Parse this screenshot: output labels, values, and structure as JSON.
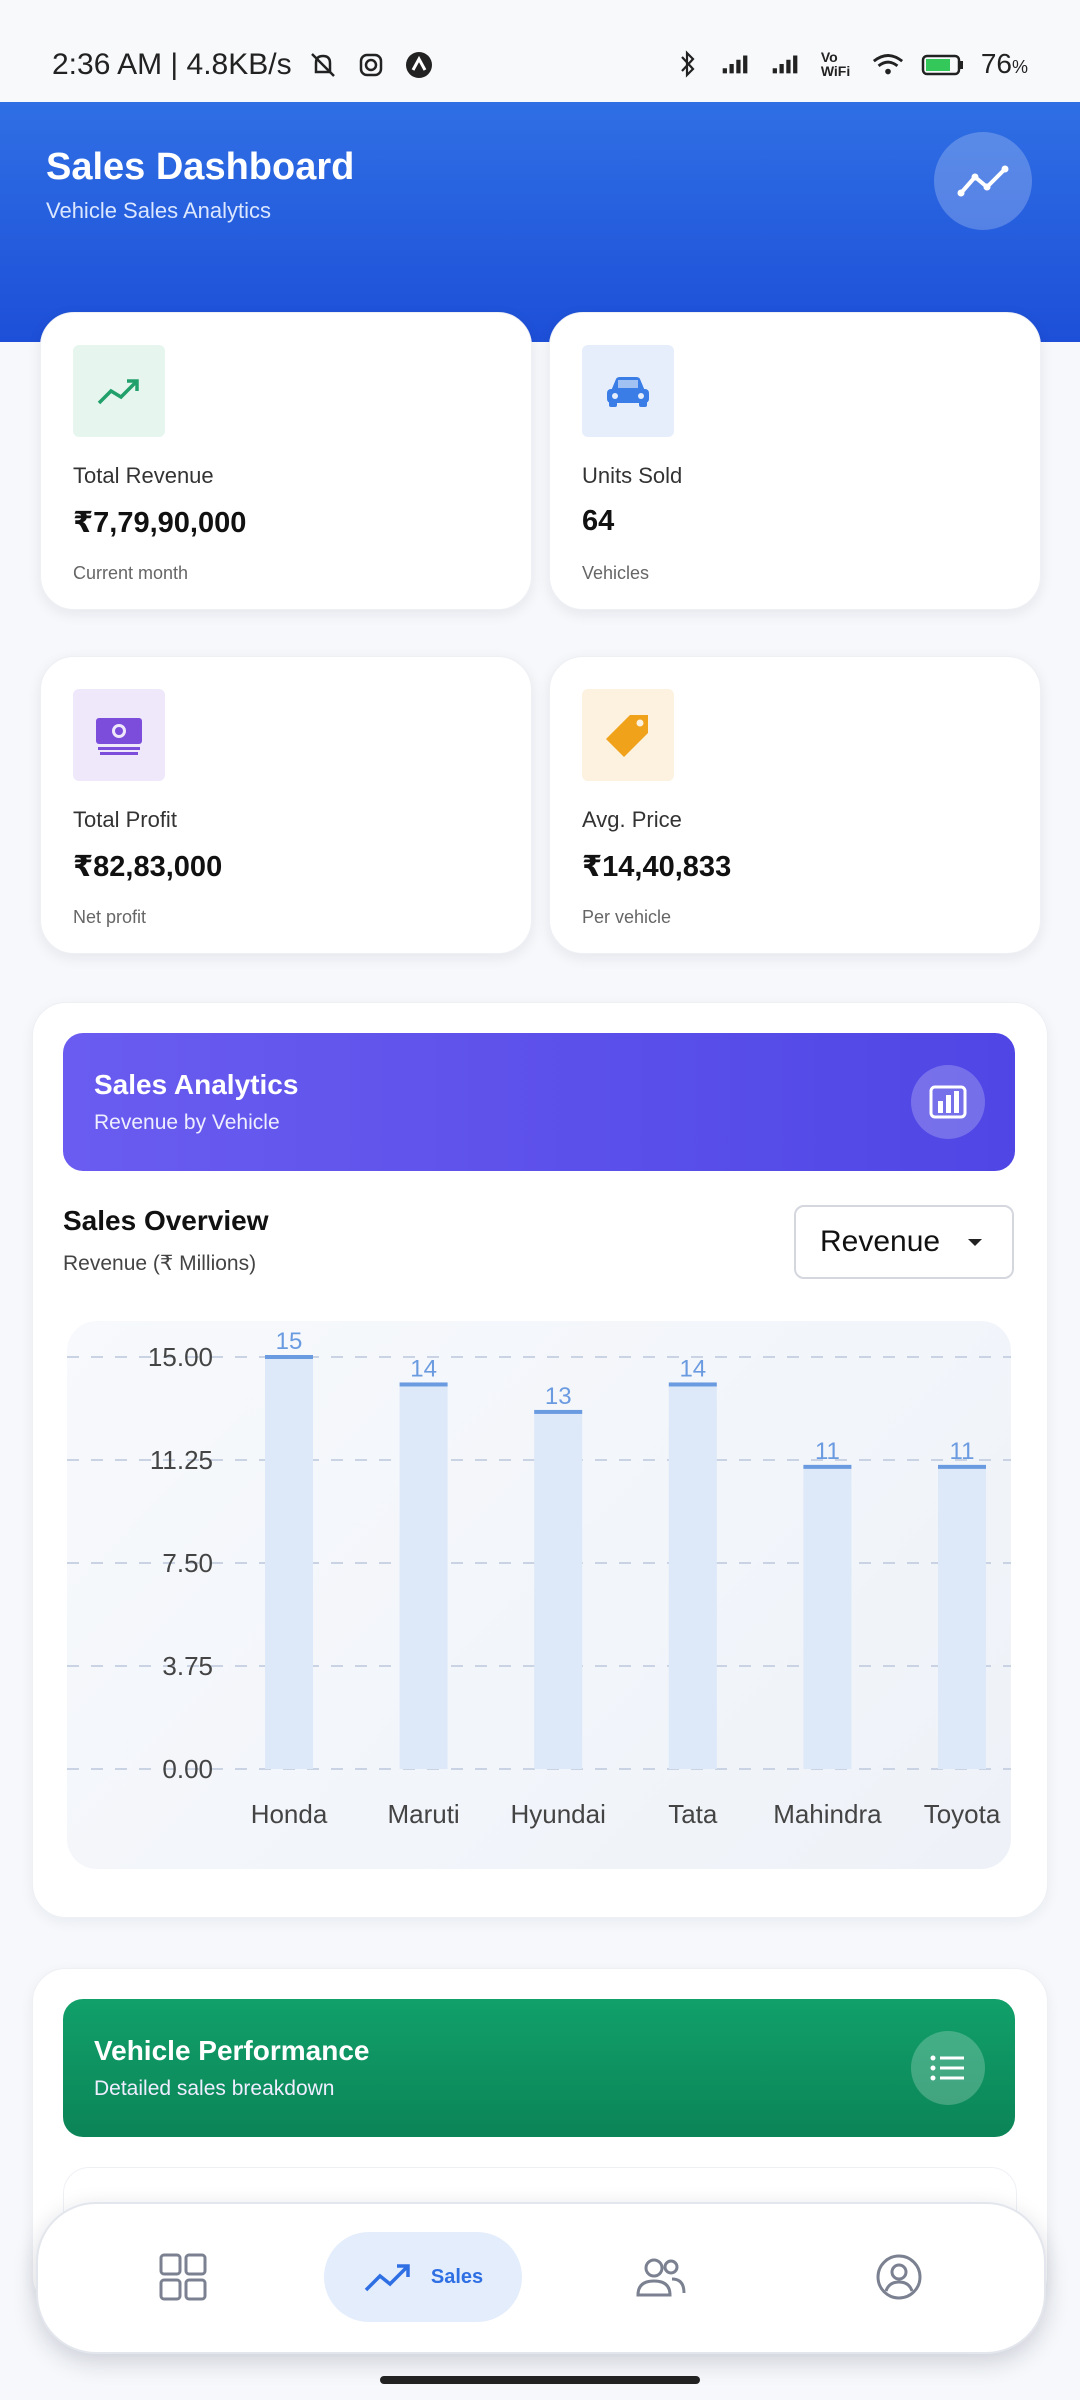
{
  "status_bar": {
    "time_speed": "2:36 AM | 4.8KB/s",
    "vowifi": "Vo WiFi",
    "battery": "76"
  },
  "header": {
    "title": "Sales Dashboard",
    "subtitle": "Vehicle Sales Analytics"
  },
  "stats": [
    {
      "label": "Total Revenue",
      "value": "₹7,79,90,000",
      "note": "Current month",
      "icon": "trending-up-icon",
      "icon_color": "#22a06b",
      "icon_bg": "#e6f6ef"
    },
    {
      "label": "Units Sold",
      "value": "64",
      "note": "Vehicles",
      "icon": "car-icon",
      "icon_color": "#3b7de6",
      "icon_bg": "#e6eefb"
    },
    {
      "label": "Total Profit",
      "value": "₹82,83,000",
      "note": "Net profit",
      "icon": "money-icon",
      "icon_color": "#7c4ddb",
      "icon_bg": "#efe8fb"
    },
    {
      "label": "Avg. Price",
      "value": "₹14,40,833",
      "note": "Per vehicle",
      "icon": "tag-icon",
      "icon_color": "#f0a21b",
      "icon_bg": "#fdf2e0"
    }
  ],
  "analytics": {
    "title": "Sales Analytics",
    "subtitle": "Revenue by Vehicle",
    "color_from": "#6a5cf0",
    "color_to": "#4f46e5"
  },
  "overview": {
    "title": "Sales Overview",
    "subtitle": "Revenue (₹ Millions)",
    "dropdown_value": "Revenue"
  },
  "chart_data": {
    "type": "bar",
    "categories": [
      "Honda",
      "Maruti",
      "Hyundai",
      "Tata",
      "Mahindra",
      "Toyota"
    ],
    "values": [
      15,
      14,
      13,
      14,
      11,
      11
    ],
    "data_labels": [
      "15",
      "14",
      "13",
      "14",
      "11",
      "11"
    ],
    "yticks": [
      "15.00",
      "11.25",
      "7.50",
      "3.75",
      "0.00"
    ],
    "ylim": [
      0,
      15
    ],
    "grid": true,
    "bar_color": "#dde8f8",
    "bar_top_color": "#6a9be0"
  },
  "performance": {
    "title": "Vehicle Performance",
    "subtitle": "Detailed sales breakdown",
    "color": "#0f9463"
  },
  "nav": {
    "items": [
      {
        "name": "dashboard",
        "icon": "grid-icon",
        "label": ""
      },
      {
        "name": "sales",
        "icon": "trending-up-icon",
        "label": "Sales"
      },
      {
        "name": "customers",
        "icon": "users-icon",
        "label": ""
      },
      {
        "name": "profile",
        "icon": "profile-icon",
        "label": ""
      }
    ]
  }
}
